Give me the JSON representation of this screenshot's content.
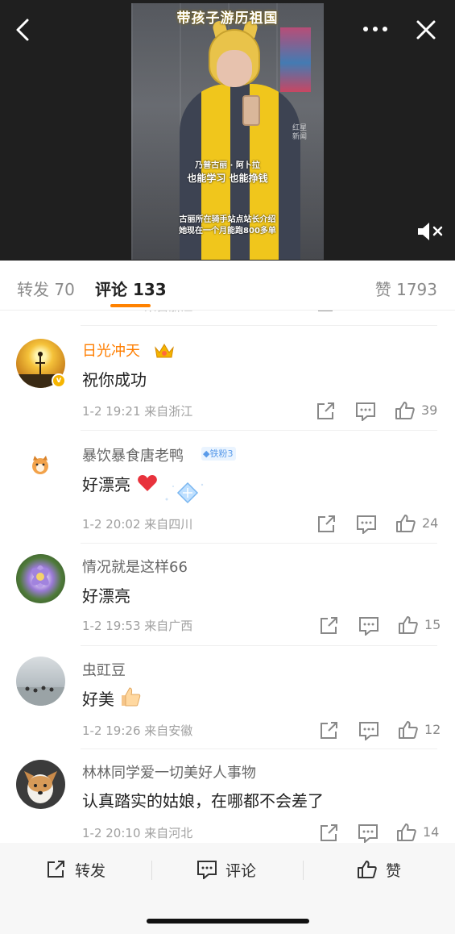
{
  "video": {
    "caption_top": "带孩子游历祖国",
    "caption_name": "乃普古丽 · 阿卜拉",
    "caption_line": "也能学习 也能挣钱",
    "caption_bottom_1": "古丽所在骑手站点站长介绍",
    "caption_bottom_2": "她现在一个月能跑800多单",
    "watermark": "红星\n新闻"
  },
  "tabs": {
    "repost": "转发 70",
    "comment": "评论 133",
    "like": "赞 1793"
  },
  "comments": [
    {
      "username": "日光冲天",
      "text": "祝你成功",
      "time": "1-2 19:21",
      "location": "来自浙江",
      "likes": "39",
      "vip": true
    },
    {
      "username": "暴饮暴食唐老鸭",
      "fan_badge": "铁粉3",
      "text": "好漂亮",
      "time": "1-2 20:02",
      "location": "来自四川",
      "likes": "24"
    },
    {
      "username": "情况就是这样66",
      "text": "好漂亮",
      "time": "1-2 19:53",
      "location": "来自广西",
      "likes": "15"
    },
    {
      "username": "虫豇豆",
      "text": "好美",
      "time": "1-2 19:26",
      "location": "来自安徽",
      "likes": "12"
    },
    {
      "username": "林林同学爱一切美好人事物",
      "text": "认真踏实的姑娘，在哪都不会差了",
      "time": "1-2 20:10",
      "location": "来自河北",
      "likes": "14"
    }
  ],
  "bottom_bar": {
    "repost": "转发",
    "comment": "评论",
    "like": "赞"
  },
  "colors": {
    "accent": "#ff8200",
    "vip_name": "#ff7e00",
    "heart": "#e8323c",
    "fan_badge": "#5a9bea"
  }
}
